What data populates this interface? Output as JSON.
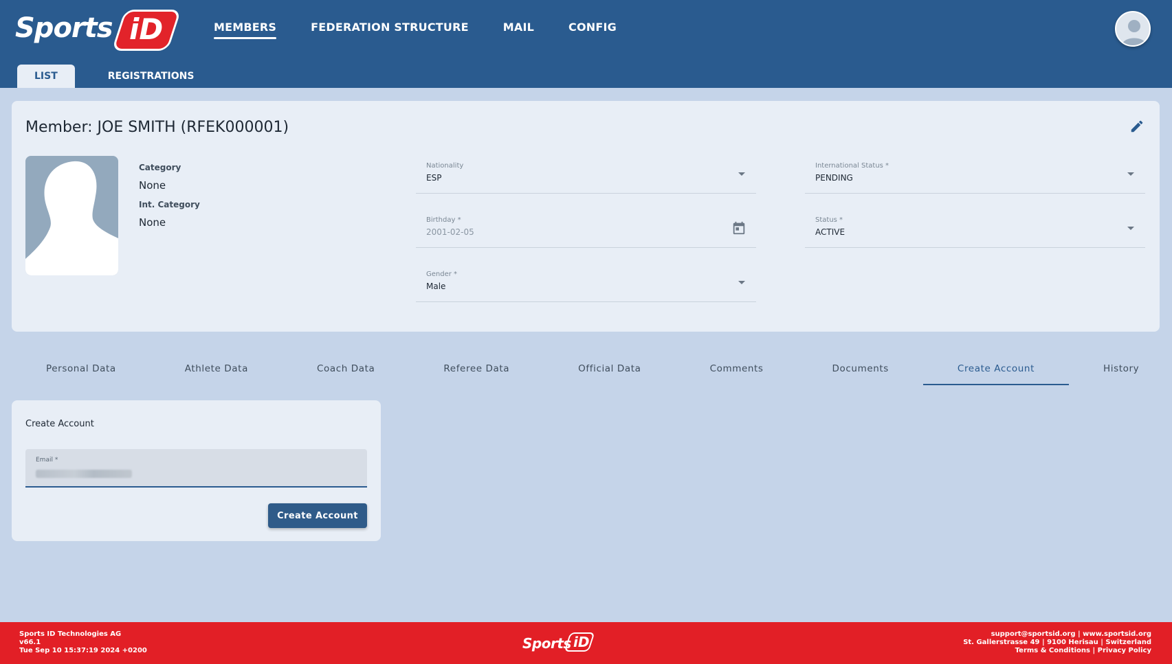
{
  "brand": {
    "logo_text": "Sports",
    "logo_badge": "iD",
    "primary_color": "#2a5b8f",
    "accent_color": "#e21f26"
  },
  "nav": {
    "items": [
      {
        "label": "MEMBERS",
        "active": true
      },
      {
        "label": "FEDERATION STRUCTURE",
        "active": false
      },
      {
        "label": "MAIL",
        "active": false
      },
      {
        "label": "CONFIG",
        "active": false
      }
    ]
  },
  "subnav": {
    "items": [
      {
        "label": "LIST",
        "active": true
      },
      {
        "label": "REGISTRATIONS",
        "active": false
      }
    ]
  },
  "member": {
    "title": "Member: JOE SMITH (RFEK000001)",
    "category_label": "Category",
    "category_value": "None",
    "int_category_label": "Int. Category",
    "int_category_value": "None",
    "fields": {
      "nationality": {
        "label": "Nationality",
        "value": "ESP"
      },
      "international_status": {
        "label": "International Status *",
        "value": "PENDING"
      },
      "birthday": {
        "label": "Birthday *",
        "value": "2001-02-05"
      },
      "status": {
        "label": "Status *",
        "value": "ACTIVE"
      },
      "gender": {
        "label": "Gender *",
        "value": "Male"
      }
    }
  },
  "tabs": [
    {
      "label": "Personal Data",
      "active": false
    },
    {
      "label": "Athlete Data",
      "active": false
    },
    {
      "label": "Coach Data",
      "active": false
    },
    {
      "label": "Referee Data",
      "active": false
    },
    {
      "label": "Official Data",
      "active": false
    },
    {
      "label": "Comments",
      "active": false
    },
    {
      "label": "Documents",
      "active": false
    },
    {
      "label": "Create Account",
      "active": true
    },
    {
      "label": "History",
      "active": false
    }
  ],
  "create_account": {
    "title": "Create Account",
    "email_label": "Email *",
    "button_label": "Create Account"
  },
  "footer": {
    "company": "Sports ID Technologies AG",
    "version": "v66.1",
    "timestamp": "Tue Sep 10 15:37:19 2024 +0200",
    "logo_text": "Sports",
    "logo_badge": "iD",
    "contact": "support@sportsid.org | www.sportsid.org",
    "address": "St. Gallerstrasse 49 | 9100 Herisau | Switzerland",
    "legal": "Terms & Conditions | Privacy Policy"
  }
}
